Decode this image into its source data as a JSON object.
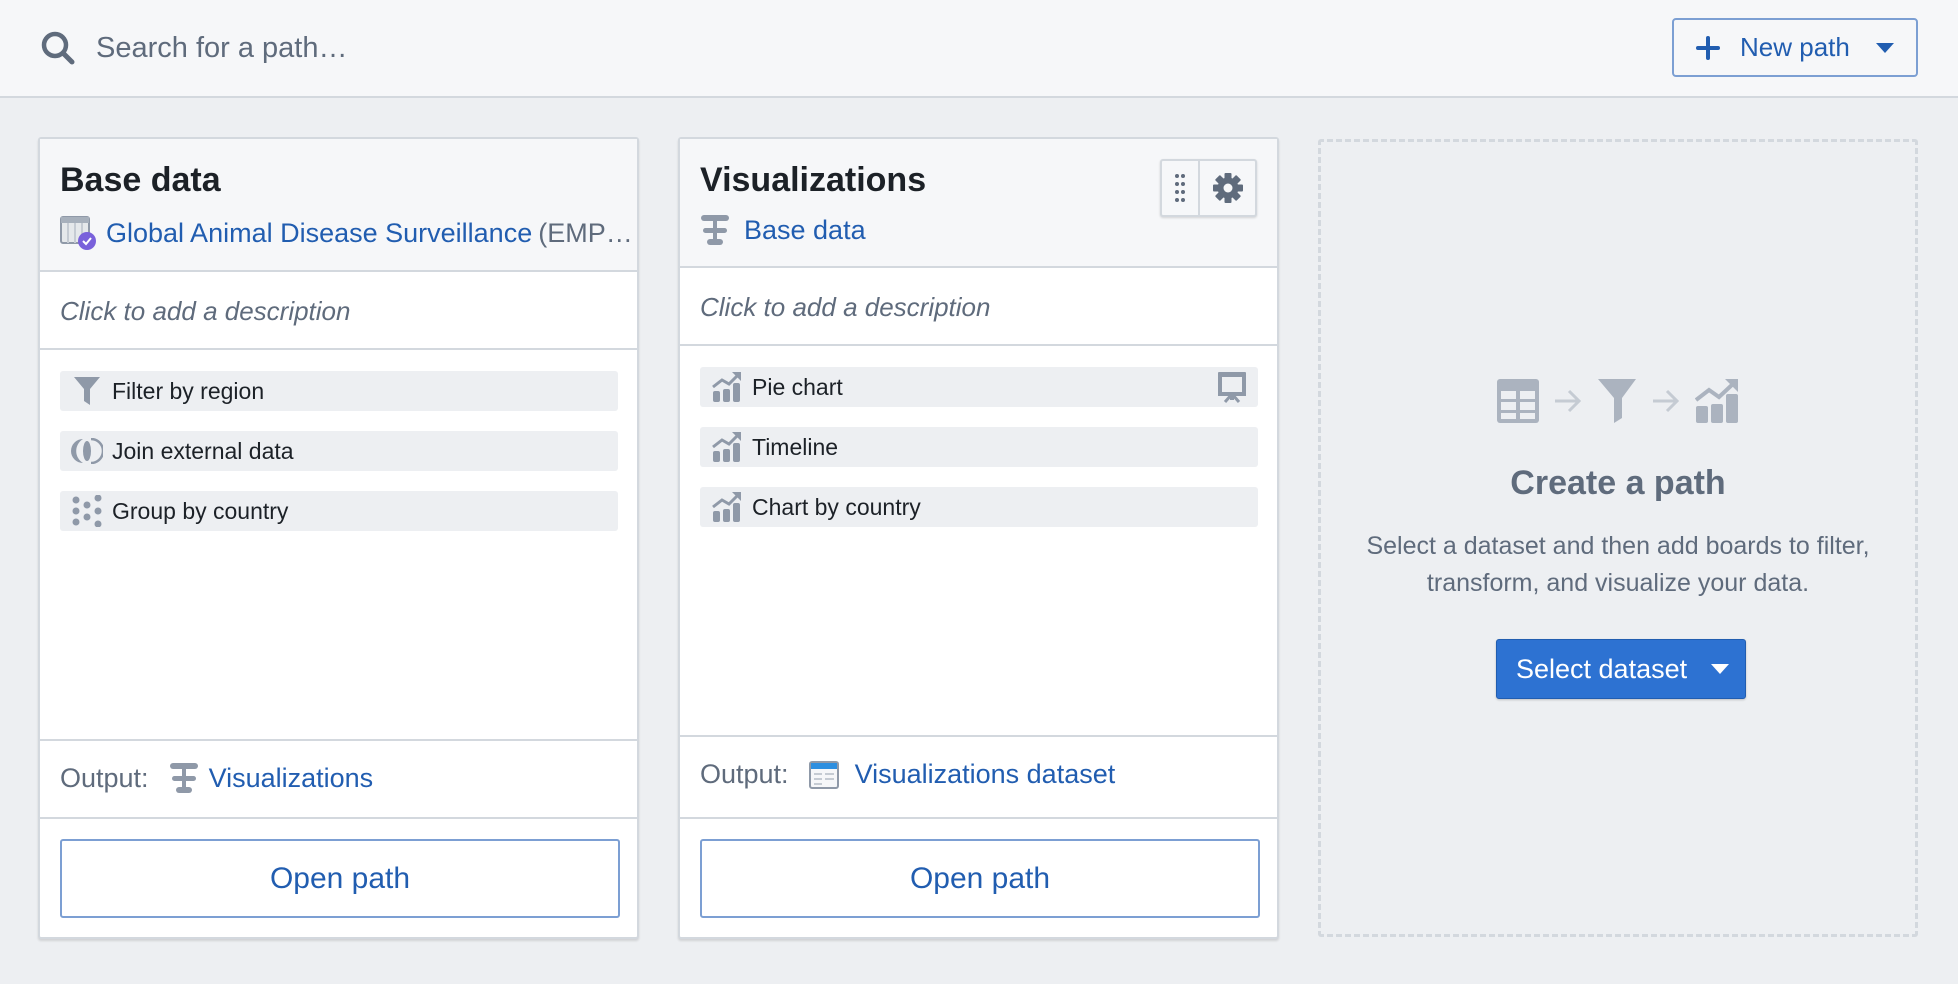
{
  "header": {
    "search": {
      "placeholder": "Search for a path…",
      "value": ""
    },
    "new_path_label": "New path"
  },
  "colors": {
    "link": "#215db0",
    "primary_button": "#2d72d2",
    "muted_text": "#5f6b7c",
    "icon_gray": "#8f99a8",
    "badge_purple": "#7961db"
  },
  "cards": [
    {
      "title": "Base data",
      "source": {
        "icon": "dataset-verified-icon",
        "name": "Global Animal Disease Surveillance",
        "suffix": "(EMP…"
      },
      "description_placeholder": "Click to add a description",
      "boards": [
        {
          "icon": "filter-icon",
          "label": "Filter by region"
        },
        {
          "icon": "join-icon",
          "label": "Join external data"
        },
        {
          "icon": "group-objects-icon",
          "label": "Group by country"
        }
      ],
      "output": {
        "label": "Output:",
        "icon": "path-icon",
        "name": "Visualizations"
      },
      "open_label": "Open path"
    },
    {
      "title": "Visualizations",
      "source": {
        "icon": "path-icon",
        "name": "Base data"
      },
      "description_placeholder": "Click to add a description",
      "boards": [
        {
          "icon": "chart-icon",
          "label": "Pie chart",
          "right_icon": "presentation-icon"
        },
        {
          "icon": "chart-icon",
          "label": "Timeline"
        },
        {
          "icon": "chart-icon",
          "label": "Chart by country"
        }
      ],
      "output": {
        "label": "Output:",
        "icon": "dataset-icon",
        "name": "Visualizations dataset"
      },
      "open_label": "Open path"
    }
  ],
  "create_path": {
    "title": "Create a path",
    "description": "Select a dataset and then add boards to filter, transform, and visualize your data.",
    "button_label": "Select dataset",
    "flow_icons": [
      "table-icon",
      "arrow-right-icon",
      "filter-icon",
      "arrow-right-icon",
      "chart-icon"
    ]
  }
}
